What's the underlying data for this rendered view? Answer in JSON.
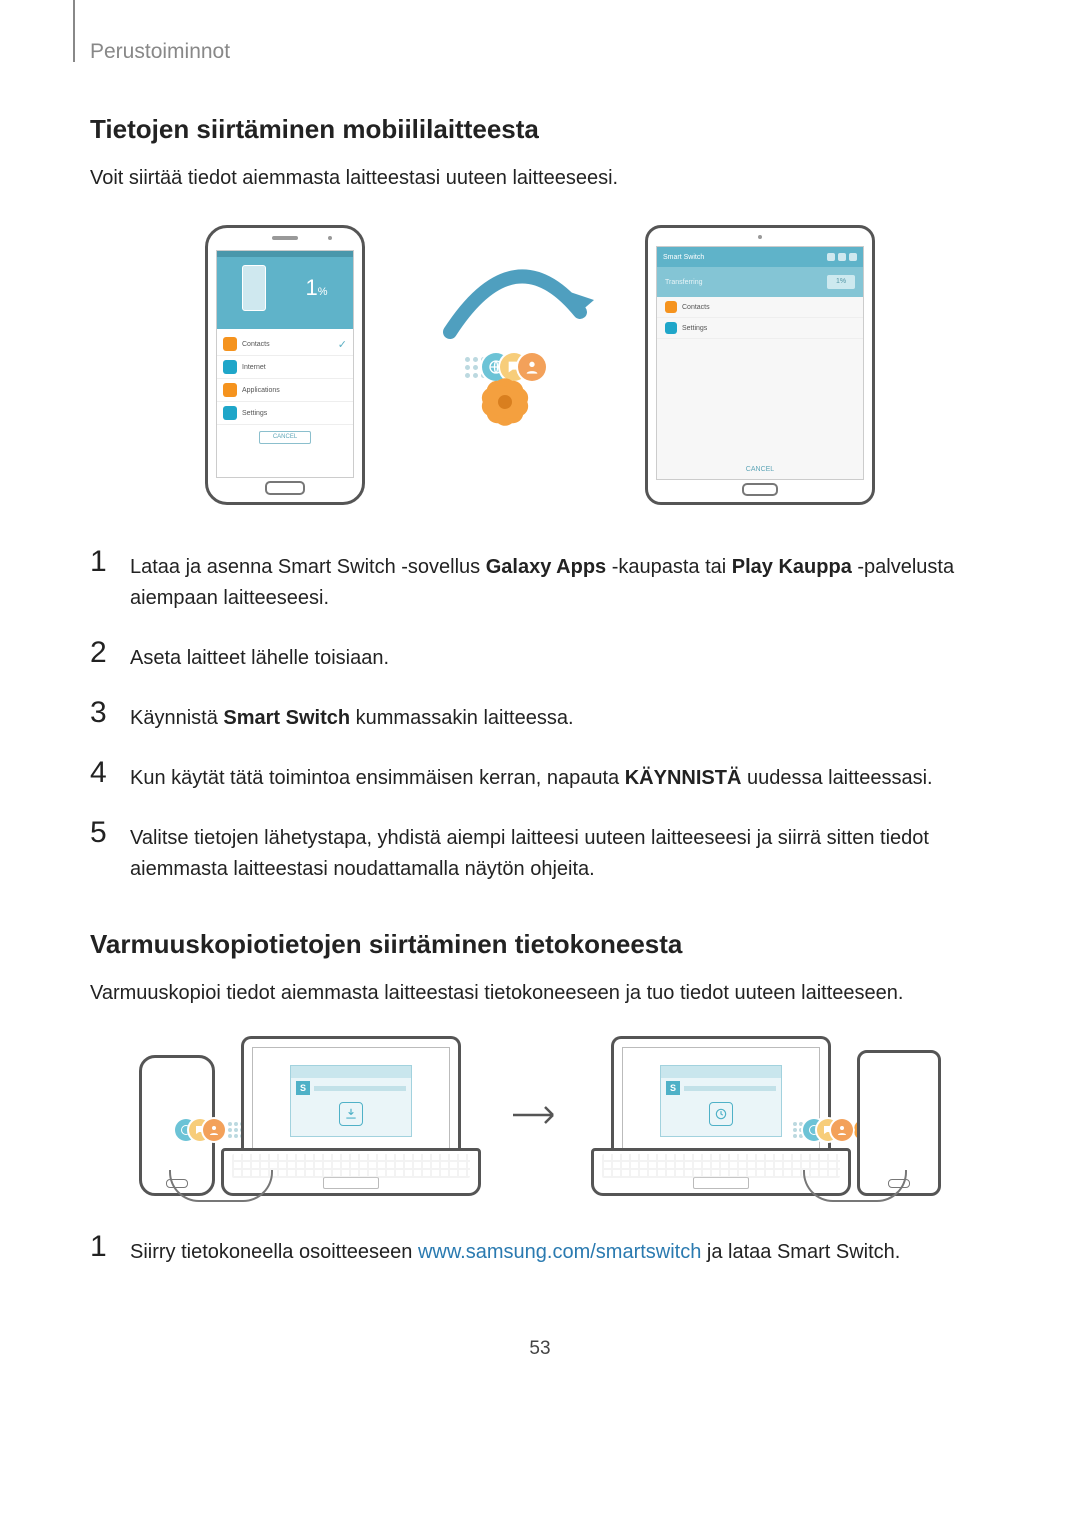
{
  "breadcrumb": "Perustoiminnot",
  "section1": {
    "title": "Tietojen siirtäminen mobiililaitteesta",
    "intro": "Voit siirtää tiedot aiemmasta laitteestasi uuteen laitteeseesi."
  },
  "phone_rows": {
    "percent": "1",
    "percent_suffix": "%",
    "r1": "Contacts",
    "r2": "Internet",
    "r3": "Applications",
    "r4": "Settings",
    "cancel": "CANCEL"
  },
  "tablet_rows": {
    "title": "Smart Switch",
    "sub": "Transferring",
    "chip": "1%",
    "r1": "Contacts",
    "r2": "Settings",
    "footer": "CANCEL"
  },
  "steps1": {
    "s1_a": "Lataa ja asenna Smart Switch -sovellus ",
    "s1_b1": "Galaxy Apps",
    "s1_c": " -kaupasta tai ",
    "s1_b2": "Play Kauppa",
    "s1_d": " -palvelusta aiempaan laitteeseesi.",
    "s2": "Aseta laitteet lähelle toisiaan.",
    "s3_a": "Käynnistä ",
    "s3_b": "Smart Switch",
    "s3_c": " kummassakin laitteessa.",
    "s4_a": "Kun käytät tätä toimintoa ensimmäisen kerran, napauta ",
    "s4_b": "KÄYNNISTÄ",
    "s4_c": " uudessa laitteessasi.",
    "s5": "Valitse tietojen lähetystapa, yhdistä aiempi laitteesi uuteen laitteeseesi ja siirrä sitten tiedot aiemmasta laitteestasi noudattamalla näytön ohjeita."
  },
  "section2": {
    "title": "Varmuuskopiotietojen siirtäminen tietokoneesta",
    "intro": "Varmuuskopioi tiedot aiemmasta laitteestasi tietokoneeseen ja tuo tiedot uuteen laitteeseen."
  },
  "laptop_panel": {
    "letter": "S"
  },
  "steps2": {
    "s1_a": "Siirry tietokoneella osoitteeseen ",
    "s1_link": "www.samsung.com/smartswitch",
    "s1_b": " ja lataa Smart Switch."
  },
  "page_number": "53"
}
